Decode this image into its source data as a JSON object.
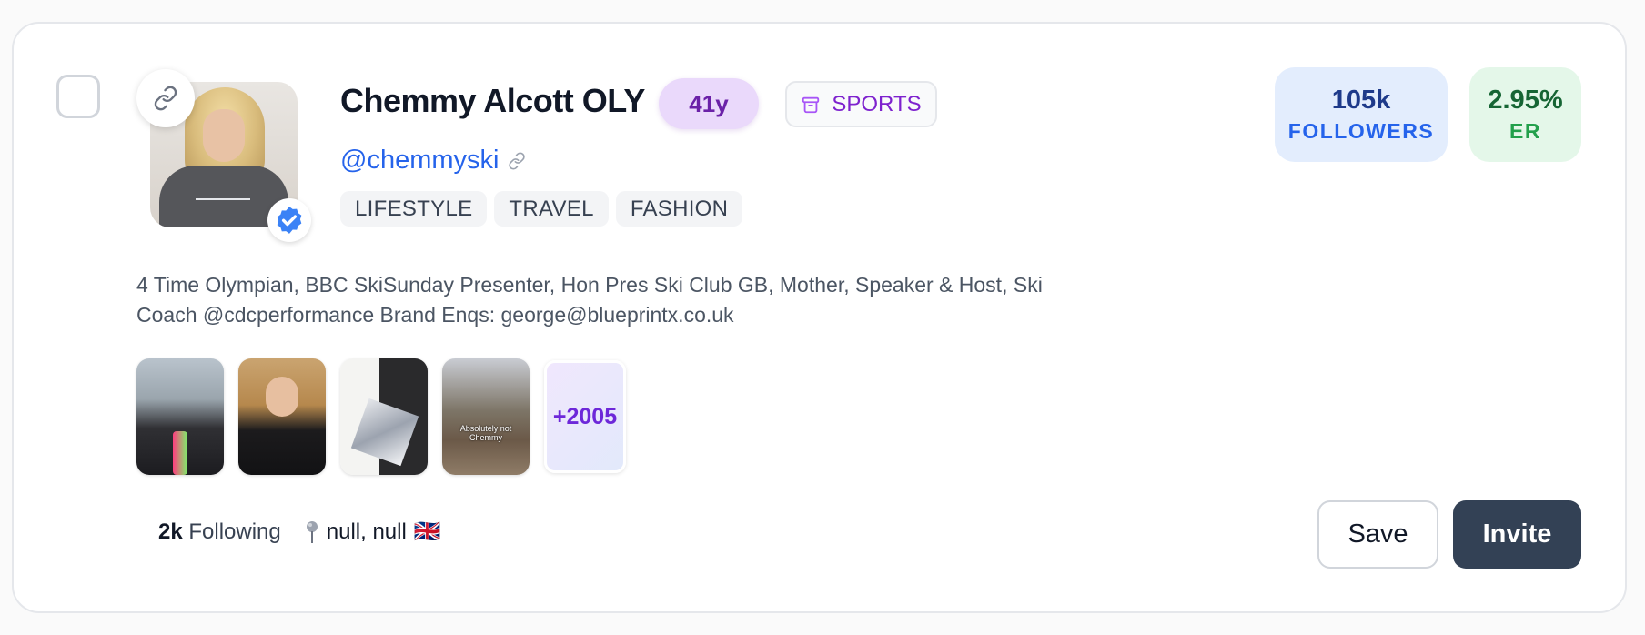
{
  "profile": {
    "name": "Chemmy Alcott OLY",
    "age": "41y",
    "category": "SPORTS",
    "handle": "@chemmyski",
    "tags": [
      "LIFESTYLE",
      "TRAVEL",
      "FASHION"
    ],
    "bio": "4 Time Olympian, BBC SkiSunday Presenter, Hon Pres Ski Club GB, Mother, Speaker & Host, Ski Coach @cdcperformance Brand Enqs: george@blueprintx.co.uk",
    "verified": true
  },
  "stats": {
    "followers_value": "105k",
    "followers_label": "FOLLOWERS",
    "er_value": "2.95%",
    "er_label": "ER"
  },
  "posts": {
    "thumb4_caption": "Absolutely not Chemmy",
    "more_label": "+2005"
  },
  "meta": {
    "following_count": "2k",
    "following_label": "Following",
    "location": "null, null",
    "flag": "🇬🇧"
  },
  "actions": {
    "save_label": "Save",
    "invite_label": "Invite"
  },
  "colors": {
    "accent_purple": "#6b21a8",
    "link_blue": "#2563eb",
    "invite_bg": "#334155"
  },
  "icons": {
    "link": "link-icon",
    "verified": "verified-badge-icon",
    "category": "archive-icon",
    "location": "pin-icon"
  }
}
